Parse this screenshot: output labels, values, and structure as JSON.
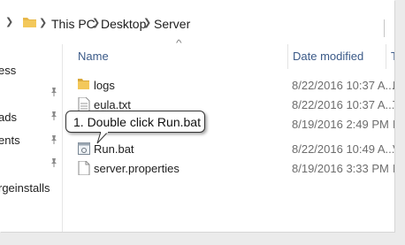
{
  "breadcrumb": [
    "This PC",
    "Desktop",
    "Server"
  ],
  "nav_items": [
    "ess",
    "ads",
    "ents",
    "rgeinstalls"
  ],
  "columns": {
    "name": "Name",
    "date_modified": "Date modified",
    "type": "T"
  },
  "files": [
    {
      "name": "logs",
      "date": "8/22/2016 10:37 A...",
      "type": "F",
      "icon": "folder-icon"
    },
    {
      "name": "eula.txt",
      "date": "8/22/2016 10:37 A...",
      "type": "T",
      "icon": "text-file-icon"
    },
    {
      "name": "",
      "date": "8/19/2016 2:49 PM",
      "type": "E",
      "icon": ""
    },
    {
      "name": "Run.bat",
      "date": "8/22/2016 10:49 A...",
      "type": "V",
      "icon": "batch-file-icon"
    },
    {
      "name": "server.properties",
      "date": "8/19/2016 3:33 PM",
      "type": "F",
      "icon": "file-icon"
    }
  ],
  "callout": {
    "text": "1. Double click Run.bat"
  },
  "colors": {
    "header_text": "#3b5a88",
    "folder": "#e8b84a",
    "background": "#ebebeb"
  }
}
